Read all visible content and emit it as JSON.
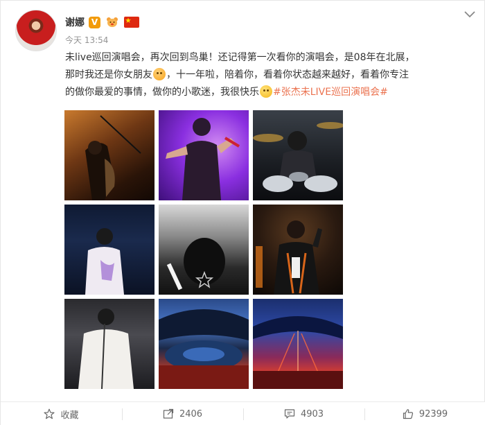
{
  "post": {
    "author": {
      "name": "谢娜",
      "verified_badge": "V",
      "badges": [
        "verified-v-badge",
        "bear-badge",
        "china-flag-badge"
      ]
    },
    "time": "今天 13:54",
    "text": {
      "line1": "未live巡回演唱会，再次回到鸟巢！还记得第一次看你的演唱会，是08年在北展，",
      "line2_before_emoji": "那时我还是你女朋友",
      "line2_after_emoji": "，十一年啦，陪着你，看着你状态越来越好，看着你专注",
      "line3_before_emoji": "的做你最爱的事情，做你的小歌迷，我很快乐",
      "topic": "#张杰未LIVE巡回演唱会#"
    },
    "photos": [
      {
        "name": "photo-singer-leaning-mic"
      },
      {
        "name": "photo-singer-purple-light"
      },
      {
        "name": "photo-drummer"
      },
      {
        "name": "photo-singer-white-shirt-stage"
      },
      {
        "name": "photo-fan-back-bw"
      },
      {
        "name": "photo-singer-black-jacket"
      },
      {
        "name": "photo-singer-white-suit"
      },
      {
        "name": "photo-stadium-overhead"
      },
      {
        "name": "photo-stadium-red-lights"
      }
    ]
  },
  "actions": {
    "favorite_label": "收藏",
    "repost_count": "2406",
    "comment_count": "4903",
    "like_count": "92399"
  },
  "colors": {
    "topic": "#eb7350",
    "verified": "#f29b0a",
    "text": "#333333",
    "meta": "#939393"
  }
}
